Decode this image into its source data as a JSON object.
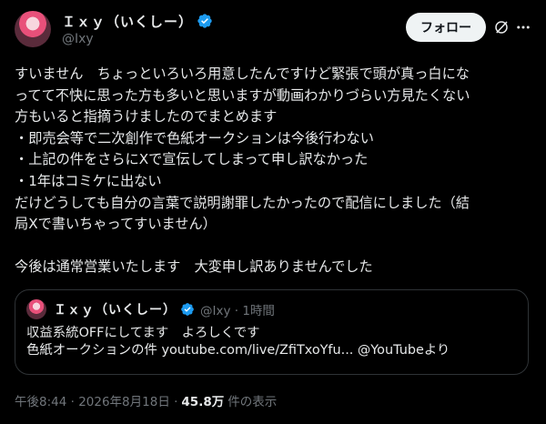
{
  "author": {
    "display_name": "Ｉｘｙ（いくしー）",
    "handle": "@Ixy"
  },
  "follow_label": "フォロー",
  "body_lines": [
    "すいません　ちょっといろいろ用意したんですけど緊張で頭が真っ白にな",
    "ってて不快に思った方も多いと思いますが動画わかりづらい方見たくない",
    "方もいると指摘うけましたのでまとめます",
    "・即売会等で二次創作で色紙オークションは今後行わない",
    "・上記の件をさらにXで宣伝してしまって申し訳なかった",
    "・1年はコミケに出ない",
    "だけどうしても自分の言葉で説明謝罪したかったので配信にしました（結",
    "局Xで書いちゃってすいません）",
    "",
    "今後は通常営業いたします　大変申し訳ありませんでした"
  ],
  "quote": {
    "display_name": "Ｉｘｙ（いくしー）",
    "handle_time": "@Ixy · 1時間",
    "line1": "収益系統OFFにしてます　よろしくです",
    "line2": "色紙オークションの件 youtube.com/live/ZfiTxoYfu... @YouTubeより"
  },
  "meta": {
    "timestamp": "午後8:44 · 2026年8月18日 ·",
    "views_count": "45.8万",
    "views_label": "件の表示"
  },
  "colors": {
    "background": "#000000",
    "text": "#e7e9ea",
    "muted": "#71767b",
    "verified": "#1d9bf0",
    "follow_bg": "#eff3f4"
  }
}
